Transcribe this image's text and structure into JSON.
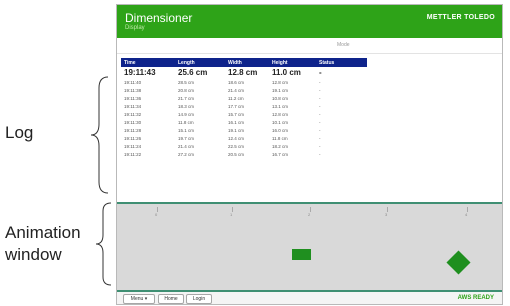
{
  "app": {
    "title": "Dimensioner",
    "subtitle": "Display",
    "brand": "METTLER TOLEDO"
  },
  "topbar": {
    "text": "Mode"
  },
  "log": {
    "headers": [
      "Time",
      "Length",
      "Width",
      "Height",
      "Status"
    ],
    "rows": [
      [
        "19:11:43",
        "25.6 cm",
        "12.8 cm",
        "11.0 cm",
        "-"
      ],
      [
        "19:11:40",
        "28.5 cm",
        "18.6 cm",
        "12.8 cm",
        "-"
      ],
      [
        "19:11:38",
        "20.8 cm",
        "21.4 cm",
        "19.1 cm",
        "-"
      ],
      [
        "19:11:36",
        "21.7 cm",
        "11.2 cm",
        "10.8 cm",
        "-"
      ],
      [
        "19:11:34",
        "18.3 cm",
        "17.7 cm",
        "13.1 cm",
        "-"
      ],
      [
        "19:11:32",
        "14.9 cm",
        "15.7 cm",
        "12.8 cm",
        "-"
      ],
      [
        "19:11:30",
        "11.8 cm",
        "16.1 cm",
        "10.1 cm",
        "-"
      ],
      [
        "19:11:28",
        "15.1 cm",
        "19.1 cm",
        "16.0 cm",
        "-"
      ],
      [
        "19:11:26",
        "19.7 cm",
        "12.4 cm",
        "11.8 cm",
        "-"
      ],
      [
        "19:11:24",
        "21.4 cm",
        "22.5 cm",
        "18.2 cm",
        "-"
      ],
      [
        "19:11:22",
        "27.2 cm",
        "20.5 cm",
        "16.7 cm",
        "-"
      ]
    ]
  },
  "animation": {
    "ticks": [
      "0",
      "1",
      "2",
      "3",
      "4",
      "5"
    ]
  },
  "footer": {
    "menu": "Menu",
    "home": "Home",
    "login": "Login",
    "status": "AWS READY"
  },
  "callouts": {
    "log": "Log",
    "animation_line1": "Animation",
    "animation_line2": "window"
  },
  "colors": {
    "accent": "#2ea318",
    "table_header": "#0e238b",
    "animation_border": "#3f8f73",
    "box": "#1f8f1f"
  }
}
